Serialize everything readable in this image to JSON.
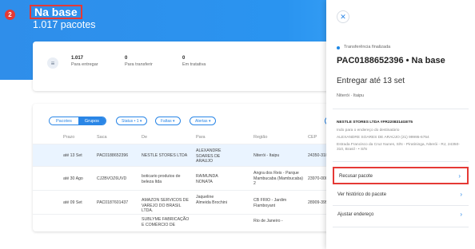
{
  "header": {
    "step_number": "2",
    "title": "Na base",
    "subtitle": "1.017 pacotes"
  },
  "summary": {
    "icon": "list-icon",
    "stats": [
      {
        "value": "1.017",
        "label": "Para entregar"
      },
      {
        "value": "0",
        "label": "Para transferir"
      },
      {
        "value": "0",
        "label": "Em tratativa"
      }
    ]
  },
  "table": {
    "segment": {
      "pacotes": "Pacotes",
      "grupos": "Grupos"
    },
    "filters": [
      "Status • 1 ▾",
      "Faltas ▾",
      "Alertas ▾"
    ],
    "columns": [
      "Prazo",
      "Saca",
      "De",
      "Para",
      "Região",
      "CEP"
    ],
    "rows": [
      {
        "prazo": "até 13 Set",
        "saca": "PAC0188652396",
        "de": "NESTLE STORES LTDA",
        "para": "ALEXANDRE SOARES DE ARAUJO",
        "regiao": "Niterói - Itaipu",
        "cep": "24350-310"
      },
      {
        "prazo": "até 30 Ago",
        "saca": "CJ2BVOZ6UVD",
        "de": "boticario produtos de beleza ltda",
        "para": "RAIMUNDA NONATA",
        "regiao": "Angra dos Reis - Parque Mambucaba (Mambucaba) 2",
        "cep": "23970-000"
      },
      {
        "prazo": "até 09 Set",
        "saca": "PAC0187601437",
        "de": "AMAZON SERVICOS DE VAREJO DO BRASIL LTDA.",
        "para": "Jaqueline Almeida Brochini",
        "regiao": "CB FRIO - Jardim Flamboyant",
        "cep": "28909-395"
      },
      {
        "prazo": "",
        "saca": "",
        "de": "SUBLYME FABRICAÇÃO E COMÉRCIO DE",
        "para": "",
        "regiao": "Rio de Janeiro -",
        "cep": ""
      }
    ]
  },
  "drawer": {
    "close_icon": "close-icon",
    "status": "Transferência finalizada",
    "package_title": "PAC0188652396 • Na base",
    "deliver_by": "Entregar até 13 set",
    "city": "Niterói · Itaipu",
    "sender": "NESTLE STORES LTDA #FR2208314GET5",
    "route_note": "Indo para o endereço do destinatário",
    "recipient": "ALEXANDRE SOARES DE ARAÚJO (21) 99995-6754",
    "address": "Estrada Francisco da Cruz Nunes, S/N - Piratininga, Niterói - RJ, 24350-310, Brasil - • S/N",
    "actions": [
      {
        "label": "Recusar pacote",
        "icon": "chevron-right-icon"
      },
      {
        "label": "Ver histórico do pacote",
        "icon": "chevron-right-icon"
      },
      {
        "label": "Ajustar endereço",
        "icon": "chevron-right-icon"
      }
    ]
  }
}
